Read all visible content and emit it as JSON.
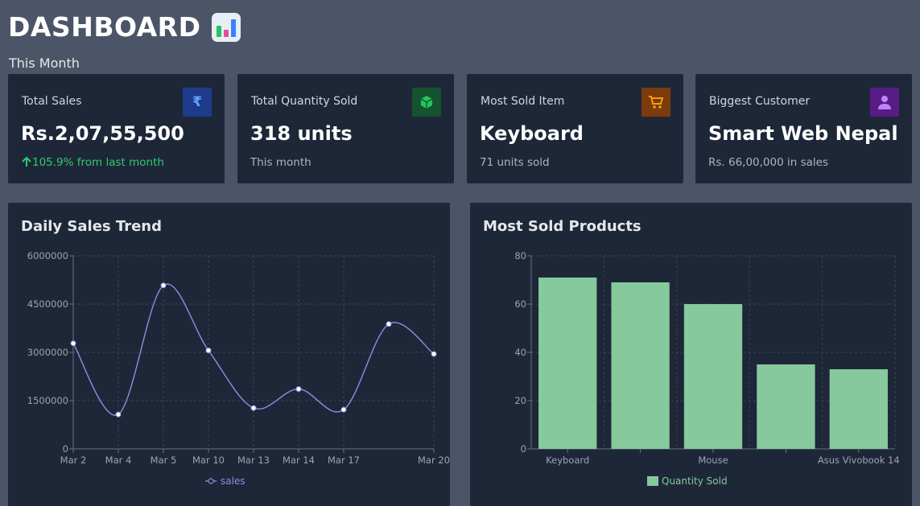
{
  "header": {
    "title": "DASHBOARD",
    "icon": "bar-chart-icon",
    "subtitle": "This Month"
  },
  "cards": [
    {
      "label": "Total Sales",
      "value": "Rs.2,07,55,500",
      "note": "105.9% from last month",
      "note_icon": "arrow-up-icon",
      "icon": "rupee-icon",
      "icon_glyph": "₹",
      "icon_bg": "#1e3a8a",
      "icon_color": "#60a5fa"
    },
    {
      "label": "Total Quantity Sold",
      "value": "318 units",
      "note": "This month",
      "icon": "box-icon",
      "icon_bg": "#14532d",
      "icon_color": "#22c55e"
    },
    {
      "label": "Most Sold Item",
      "value": "Keyboard",
      "note": "71 units sold",
      "icon": "cart-icon",
      "icon_bg": "#7c3b0a",
      "icon_color": "#f59e0b"
    },
    {
      "label": "Biggest Customer",
      "value": "Smart Web Nepal",
      "note": "Rs. 66,00,000 in sales",
      "icon": "user-icon",
      "icon_bg": "#581c87",
      "icon_color": "#c084fc"
    }
  ],
  "panels": {
    "line_title": "Daily Sales Trend",
    "bar_title": "Most Sold Products"
  },
  "chart_data": [
    {
      "type": "line",
      "title": "Daily Sales Trend",
      "x_ticks": [
        "Mar 2",
        "Mar 4",
        "Mar 5",
        "Mar 10",
        "Mar 13",
        "Mar 14",
        "Mar 17",
        "Mar 20"
      ],
      "y_ticks": [
        "0",
        "1500000",
        "3000000",
        "4500000",
        "6000000"
      ],
      "ylim": [
        0,
        6000000
      ],
      "series": [
        {
          "name": "sales",
          "color": "#8b8fe0",
          "values": [
            3280000,
            1070000,
            5080000,
            3060000,
            1270000,
            1860000,
            1220000,
            3880000,
            2950000
          ]
        }
      ],
      "grid": true,
      "legend": "bottom"
    },
    {
      "type": "bar",
      "title": "Most Sold Products",
      "categories": [
        "Keyboard",
        "",
        "Mouse",
        "",
        "Asus Vivobook 14"
      ],
      "y_ticks": [
        "0",
        "20",
        "40",
        "60",
        "80"
      ],
      "ylim": [
        0,
        80
      ],
      "series": [
        {
          "name": "Quantity Sold",
          "color": "#86c99c",
          "values": [
            71,
            69,
            60,
            35,
            33
          ]
        }
      ],
      "grid": true,
      "legend": "bottom"
    }
  ]
}
